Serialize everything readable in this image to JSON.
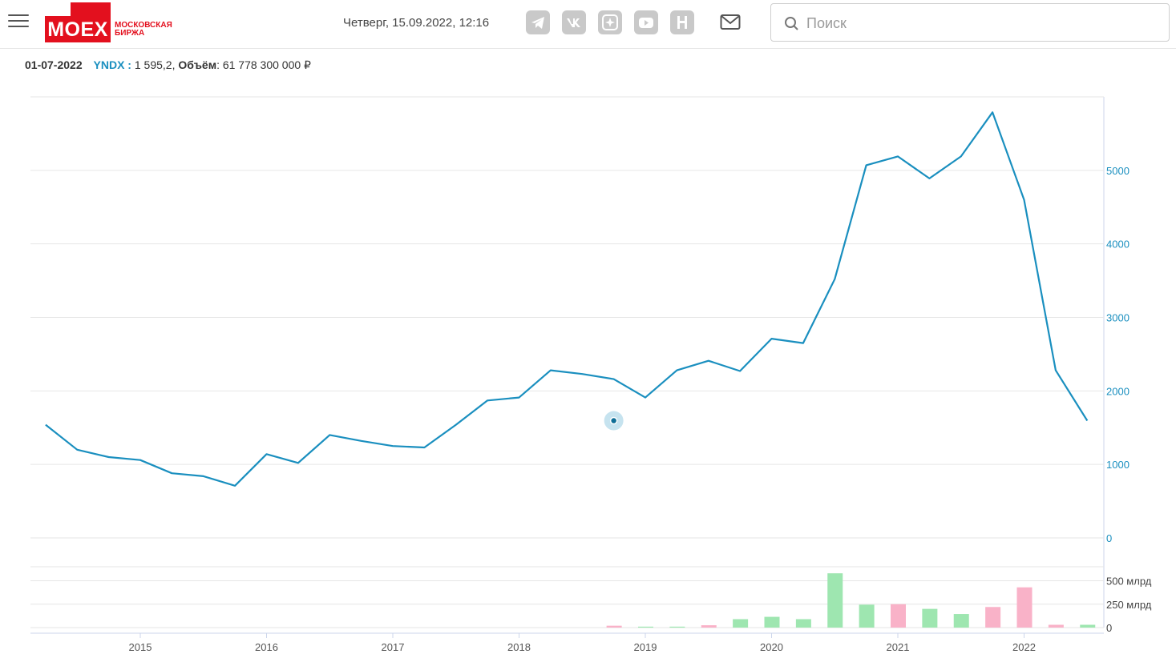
{
  "header": {
    "logo_text": "MOEX",
    "logo_sub_line1": "МОСКОВСКАЯ",
    "logo_sub_line2": "БИРЖА",
    "datetime": "Четверг, 15.09.2022, 12:16",
    "social_icons": [
      "telegram-icon",
      "vk-icon",
      "zen-icon",
      "youtube-icon",
      "news-icon"
    ],
    "search_placeholder": "Поиск"
  },
  "info": {
    "date": "01-07-2022",
    "ticker": "YNDX :",
    "price": "1 595,2,",
    "volume_label": "Объём",
    "volume_value": ": 61 778 300 000 ₽"
  },
  "colors": {
    "line": "#1a8fbf",
    "axis_text": "#1a8fbf",
    "grid": "#e6e6e6",
    "bar_up": "#9ee6b0",
    "bar_down": "#f9b2c8",
    "accent": "#e3101e"
  },
  "chart_data": [
    {
      "type": "line",
      "series": [
        {
          "x": [
            "2014-04",
            "2014-07",
            "2014-10",
            "2015-01",
            "2015-04",
            "2015-07",
            "2015-10",
            "2016-01",
            "2016-04",
            "2016-07",
            "2016-10",
            "2017-01",
            "2017-04",
            "2017-07",
            "2017-10",
            "2018-01",
            "2018-04",
            "2018-07",
            "2018-10",
            "2019-01",
            "2019-04",
            "2019-07",
            "2019-10",
            "2020-01",
            "2020-04",
            "2020-07",
            "2020-10",
            "2021-01",
            "2021-04",
            "2021-07",
            "2021-10",
            "2022-01",
            "2022-04",
            "2022-07"
          ],
          "values": [
            1540,
            1200,
            1100,
            1060,
            880,
            840,
            710,
            1140,
            1020,
            1400,
            1320,
            1250,
            1230,
            1540,
            1870,
            1910,
            2280,
            2230,
            2160,
            1910,
            2280,
            2410,
            2270,
            2710,
            2650,
            3520,
            5070,
            5190,
            4890,
            5190,
            5790,
            4600,
            2280,
            1595
          ]
        }
      ],
      "y_ticks": [
        "0",
        "1000",
        "2000",
        "3000",
        "4000",
        "5000"
      ],
      "ylim": [
        0,
        6000
      ],
      "y_axis_position": "right",
      "grid": true,
      "marker": {
        "x": "2018-10",
        "y": 1595
      }
    },
    {
      "type": "bar",
      "x": [
        "2018-10",
        "2019-01",
        "2019-04",
        "2019-07",
        "2019-10",
        "2020-01",
        "2020-04",
        "2020-07",
        "2020-10",
        "2021-01",
        "2021-04",
        "2021-07",
        "2021-10",
        "2022-01",
        "2022-04",
        "2022-07"
      ],
      "values": [
        20,
        10,
        10,
        25,
        90,
        115,
        90,
        580,
        245,
        250,
        200,
        145,
        220,
        430,
        30,
        30
      ],
      "direction": [
        "down",
        "up",
        "up",
        "down",
        "up",
        "up",
        "up",
        "up",
        "up",
        "down",
        "up",
        "up",
        "down",
        "down",
        "down",
        "up"
      ],
      "y_ticks": [
        "0",
        "250 млрд",
        "500 млрд"
      ],
      "ylim": [
        0,
        650
      ],
      "y_axis_position": "right",
      "grid": true
    }
  ],
  "x_ticks": [
    "2015",
    "2016",
    "2017",
    "2018",
    "2019",
    "2020",
    "2021",
    "2022"
  ]
}
